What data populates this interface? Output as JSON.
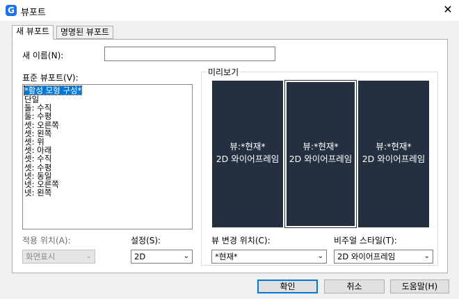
{
  "window": {
    "title": "뷰포트",
    "app_icon_letter": "G",
    "close_glyph": "✕"
  },
  "tabs": [
    {
      "label": "새 뷰포트",
      "active": true
    },
    {
      "label": "명명된 뷰포트",
      "active": false
    }
  ],
  "new_name": {
    "label": "새 이름(N):",
    "value": ""
  },
  "standard": {
    "label": "표준 뷰포트(V):",
    "items": [
      "*활성 모형 구성*",
      "단일",
      "둘: 수직",
      "둘: 수평",
      "셋: 오른쪽",
      "셋: 왼쪽",
      "셋: 위",
      "셋: 아래",
      "셋: 수직",
      "셋: 수평",
      "넷: 동일",
      "넷: 오른쪽",
      "넷: 왼쪽"
    ],
    "selected_index": 0
  },
  "preview": {
    "label": "미리보기",
    "panes": [
      {
        "line1": "뷰:*현재*",
        "line2": "2D 와이어프레임"
      },
      {
        "line1": "뷰:*현재*",
        "line2": "2D 와이어프레임"
      },
      {
        "line1": "뷰:*현재*",
        "line2": "2D 와이어프레임"
      }
    ]
  },
  "apply_to": {
    "label": "적용 위치(A):",
    "value": "화면표시"
  },
  "setup": {
    "label": "설정(S):",
    "value": "2D"
  },
  "change_view": {
    "label": "뷰 변경 위치(C):",
    "value": "*현재*"
  },
  "visual_style": {
    "label": "비주얼 스타일(T):",
    "value": "2D 와이어프레임"
  },
  "buttons": {
    "ok": "확인",
    "cancel": "취소",
    "help": "도움말(H)"
  },
  "colors": {
    "preview_bg": "#243040",
    "selection": "#0078d7",
    "default_border": "#0078d7"
  }
}
